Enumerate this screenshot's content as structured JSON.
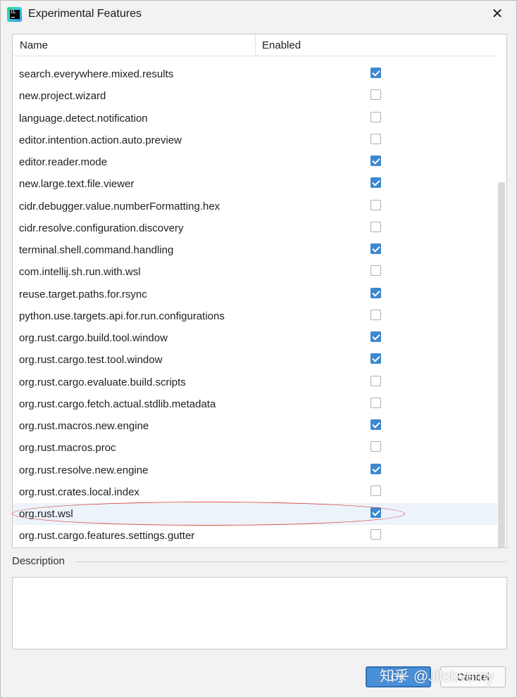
{
  "window": {
    "title": "Experimental Features",
    "icon": "clion-app-icon",
    "icon_text": "CL",
    "close_glyph": "✕"
  },
  "table": {
    "columns": [
      "Name",
      "Enabled"
    ],
    "rows": [
      {
        "name": "search.everywhere.mixed.results",
        "enabled": true
      },
      {
        "name": "new.project.wizard",
        "enabled": false
      },
      {
        "name": "language.detect.notification",
        "enabled": false
      },
      {
        "name": "editor.intention.action.auto.preview",
        "enabled": false
      },
      {
        "name": "editor.reader.mode",
        "enabled": true
      },
      {
        "name": "new.large.text.file.viewer",
        "enabled": true
      },
      {
        "name": "cidr.debugger.value.numberFormatting.hex",
        "enabled": false
      },
      {
        "name": "cidr.resolve.configuration.discovery",
        "enabled": false
      },
      {
        "name": "terminal.shell.command.handling",
        "enabled": true
      },
      {
        "name": "com.intellij.sh.run.with.wsl",
        "enabled": false
      },
      {
        "name": "reuse.target.paths.for.rsync",
        "enabled": true
      },
      {
        "name": "python.use.targets.api.for.run.configurations",
        "enabled": false
      },
      {
        "name": "org.rust.cargo.build.tool.window",
        "enabled": true
      },
      {
        "name": "org.rust.cargo.test.tool.window",
        "enabled": true
      },
      {
        "name": "org.rust.cargo.evaluate.build.scripts",
        "enabled": false
      },
      {
        "name": "org.rust.cargo.fetch.actual.stdlib.metadata",
        "enabled": false
      },
      {
        "name": "org.rust.macros.new.engine",
        "enabled": true
      },
      {
        "name": "org.rust.macros.proc",
        "enabled": false
      },
      {
        "name": "org.rust.resolve.new.engine",
        "enabled": true
      },
      {
        "name": "org.rust.crates.local.index",
        "enabled": false
      },
      {
        "name": "org.rust.wsl",
        "enabled": true,
        "selected": true
      },
      {
        "name": "org.rust.cargo.features.settings.gutter",
        "enabled": false
      }
    ]
  },
  "description": {
    "label": "Description",
    "text": ""
  },
  "buttons": {
    "ok": "OK",
    "cancel": "Cancel"
  },
  "watermark": "知乎 @Jllobvemy",
  "colors": {
    "accent": "#3c89cf",
    "selected_row": "#edf3fb",
    "annotation": "#d9534f"
  }
}
